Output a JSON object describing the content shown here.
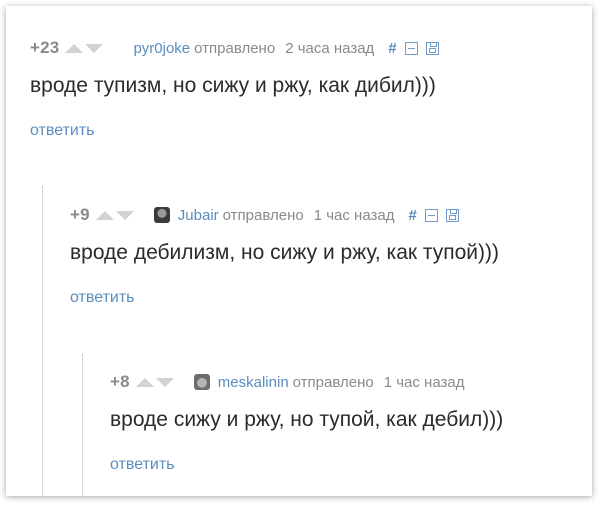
{
  "comments": [
    {
      "score": "+23",
      "username": "pyr0joke",
      "sent_label": "отправлено",
      "time": "2 часа назад",
      "text": "вроде тупизм, но сижу и ржу, как дибил)))",
      "reply_label": "ответить",
      "link_symbol": "#",
      "has_avatar": false,
      "icons": [
        "vote-up-icon",
        "vote-down-icon",
        "collapse-icon",
        "save-icon"
      ]
    },
    {
      "score": "+9",
      "username": "Jubair",
      "sent_label": "отправлено",
      "time": "1 час назад",
      "text": "вроде дебилизм, но сижу и ржу, как тупой)))",
      "reply_label": "ответить",
      "link_symbol": "#",
      "has_avatar": true,
      "icons": [
        "vote-up-icon",
        "vote-down-icon",
        "avatar",
        "collapse-icon",
        "save-icon"
      ]
    },
    {
      "score": "+8",
      "username": "meskalinin",
      "sent_label": "отправлено",
      "time": "1 час назад",
      "text": "вроде сижу и ржу, но тупой, как дебил)))",
      "reply_label": "ответить",
      "has_avatar": true,
      "icons": [
        "vote-up-icon",
        "vote-down-icon",
        "avatar"
      ]
    }
  ],
  "colors": {
    "link": "#5a8cbf",
    "meta_gray": "#8a8a8a",
    "text": "#2b2b2b",
    "vote_arrow": "#d2d2d2"
  }
}
